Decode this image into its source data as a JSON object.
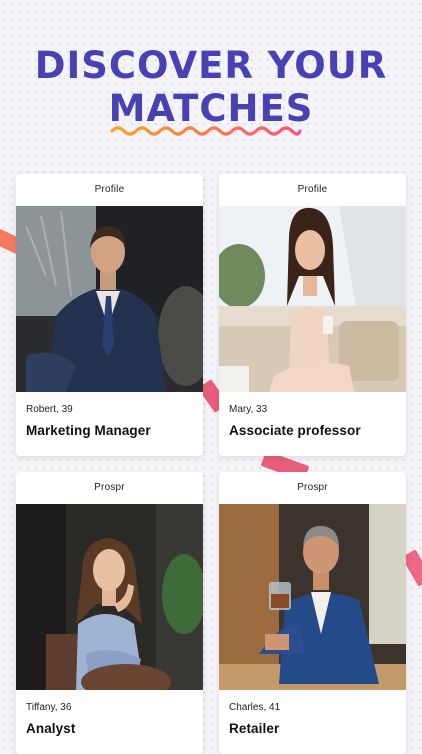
{
  "headline": {
    "line1": "DISCOVER YOUR",
    "line2": "MATCHES"
  },
  "colors": {
    "accent": "#4841b3",
    "wave_start": "#f5a623",
    "wave_end": "#ff4f7b",
    "stripe": "#ee6e80"
  },
  "cards": [
    {
      "header": "Profile",
      "name_age": "Robert, 39",
      "job": "Marketing Manager",
      "photo_icon": "man-in-suit-photo"
    },
    {
      "header": "Profile",
      "name_age": "Mary, 33",
      "job": "Associate professor",
      "photo_icon": "woman-on-sofa-photo"
    },
    {
      "header": "Prospr",
      "name_age": "Tiffany, 36",
      "job": "Analyst",
      "photo_icon": "woman-posing-photo"
    },
    {
      "header": "Prospr",
      "name_age": "Charles, 41",
      "job": "Retailer",
      "photo_icon": "man-with-glass-photo"
    }
  ]
}
